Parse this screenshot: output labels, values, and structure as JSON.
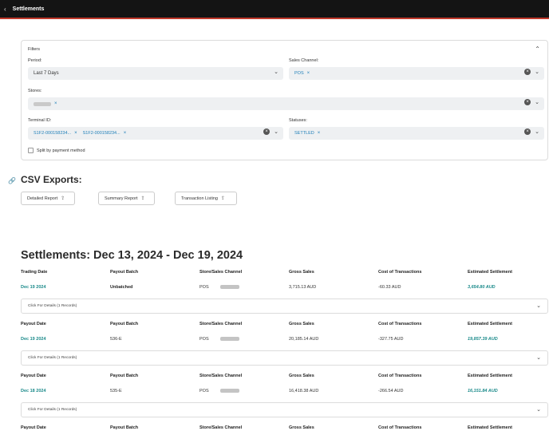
{
  "header": {
    "back_icon": "‹",
    "title": "Settlements"
  },
  "filters": {
    "title": "Filters",
    "period": {
      "label": "Period:",
      "value": "Last 7 Days"
    },
    "sales_channel": {
      "label": "Sales Channel:",
      "chips": [
        "POS"
      ]
    },
    "stores": {
      "label": "Stores:"
    },
    "terminal_id": {
      "label": "Terminal ID:",
      "chips": [
        "S1F2-000158234...",
        "S1F2-000158234..."
      ]
    },
    "statuses": {
      "label": "Statuses:",
      "chips": [
        "SETTLED"
      ]
    },
    "split_label": "Split by payment method",
    "remove_glyph": "×",
    "chevron_down": "⌄",
    "chevron_up": "⌃"
  },
  "csv": {
    "title": "CSV Exports:",
    "buttons": [
      "Detailed Report",
      "Summary Report",
      "Transaction Listing"
    ],
    "download_glyph": "⇪"
  },
  "settlements": {
    "title": "Settlements: Dec 13, 2024 - Dec 19, 2024",
    "rows": [
      {
        "headers": [
          "Trading Date",
          "Payout Batch",
          "Store/Sales Channel",
          "Gross Sales",
          "Cost of Transactions",
          "Estimated Settlement"
        ],
        "date": "Dec 19 2024",
        "batch": "Unbatched",
        "store": "POS",
        "gross": "3,715.13 AUD",
        "cost": "-60.33 AUD",
        "est": "3,654.80 AUD",
        "details": "Click For Details (1 Records)"
      },
      {
        "headers": [
          "Payout Date",
          "Payout Batch",
          "Store/Sales Channel",
          "Gross Sales",
          "Cost of Transactions",
          "Estimated Settlement"
        ],
        "date": "Dec 19 2024",
        "batch": "536-E",
        "store": "POS",
        "gross": "20,185.14 AUD",
        "cost": "-327.75 AUD",
        "est": "19,857.39 AUD",
        "details": "Click For Details (1 Records)"
      },
      {
        "headers": [
          "Payout Date",
          "Payout Batch",
          "Store/Sales Channel",
          "Gross Sales",
          "Cost of Transactions",
          "Estimated Settlement"
        ],
        "date": "Dec 18 2024",
        "batch": "535-E",
        "store": "POS",
        "gross": "16,418.38 AUD",
        "cost": "-266.54 AUD",
        "est": "16,151.84 AUD",
        "details": "Click For Details (1 Records)"
      },
      {
        "headers": [
          "Payout Date",
          "Payout Batch",
          "Store/Sales Channel",
          "Gross Sales",
          "Cost of Transactions",
          "Estimated Settlement"
        ]
      }
    ]
  }
}
